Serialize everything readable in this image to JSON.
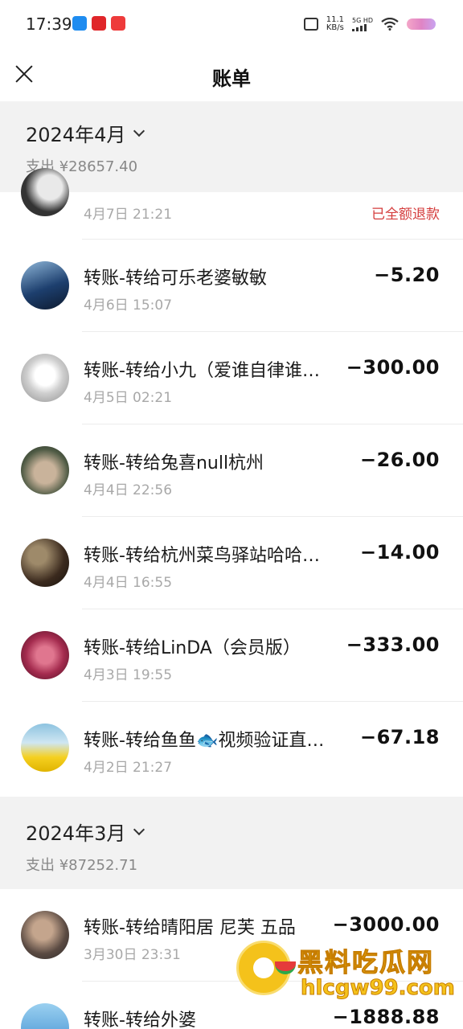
{
  "status_bar": {
    "time": "17:39",
    "net_speed_value": "11.1",
    "net_speed_unit": "KB/s",
    "network_label": "5G HD"
  },
  "header": {
    "title": "账单"
  },
  "months": [
    {
      "label": "2024年4月",
      "total": "支出 ¥28657.40",
      "items": [
        {
          "title": "",
          "time": "4月7日 21:21",
          "amount": "",
          "status": "已全额退款",
          "avatar_colors": [
            "#333333",
            "#e9e9e9"
          ]
        },
        {
          "title": "转账-转给可乐老婆敏敏",
          "time": "4月6日 15:07",
          "amount": "−5.20",
          "avatar_colors": [
            "#1d3f6e",
            "#8fb7d9"
          ]
        },
        {
          "title": "转账-转给小九（爱谁自律谁…",
          "time": "4月5日 02:21",
          "amount": "−300.00",
          "avatar_colors": [
            "#f0f0f0",
            "#b5b5b5"
          ]
        },
        {
          "title": "转账-转给兔喜null杭州",
          "time": "4月4日 22:56",
          "amount": "−26.00",
          "avatar_colors": [
            "#4e5a44",
            "#c9b39b"
          ]
        },
        {
          "title": "转账-转给杭州菜鸟驿站哈哈…",
          "time": "4月4日 16:55",
          "amount": "−14.00",
          "avatar_colors": [
            "#3b2a1e",
            "#9e8a6a"
          ]
        },
        {
          "title": "转账-转给LinDA（会员版）",
          "time": "4月3日 19:55",
          "amount": "−333.00",
          "avatar_colors": [
            "#7a1e3a",
            "#e0768f"
          ]
        },
        {
          "title": "转账-转给鱼鱼🐟视频验证直…",
          "time": "4月2日 21:27",
          "amount": "−67.18",
          "avatar_colors": [
            "#8dc3e0",
            "#f5d020"
          ]
        }
      ]
    },
    {
      "label": "2024年3月",
      "total": "支出 ¥87252.71",
      "items": [
        {
          "title": "转账-转给晴阳居 尼芙 五品",
          "time": "3月30日 23:31",
          "amount": "−3000.00",
          "avatar_colors": [
            "#2c2a2a",
            "#c4a58d"
          ]
        },
        {
          "title": "转账-转给外婆",
          "time": "",
          "amount": "−1888.88",
          "avatar_colors": [
            "#3f8ed1",
            "#9ad0f0"
          ]
        }
      ]
    }
  ],
  "watermark": {
    "name": "黑料吃瓜网",
    "url": "hlcgw99.com"
  }
}
